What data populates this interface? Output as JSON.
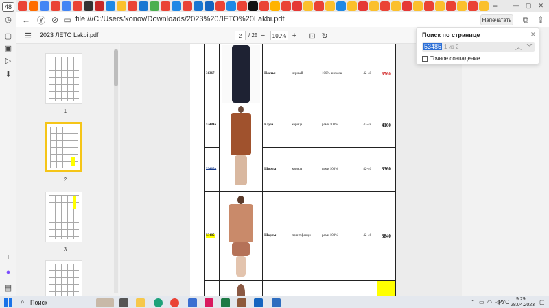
{
  "sidebar": {
    "tab_count": "48"
  },
  "browser": {
    "url": "file:///C:/Users/konov/Downloads/2023%20ЛЕТО%20Lakbi.pdf",
    "print_label": "Напечатать"
  },
  "pdf_toolbar": {
    "doc_title": "2023 ЛЕТО Lakbi.pdf",
    "current_page": "2",
    "total_pages": "/ 25",
    "zoom": "100%"
  },
  "thumbnails": [
    {
      "number": "1"
    },
    {
      "number": "2"
    },
    {
      "number": "3"
    }
  ],
  "catalog": {
    "rows": [
      {
        "article": "31367",
        "name": "Платье",
        "color": "черный",
        "composition": "100% вискоза",
        "sizes": "42-48",
        "price": "6560",
        "price_color": "#d32f2f"
      },
      {
        "article": "53484а",
        "name": "Блуза",
        "color": "корица",
        "composition": "рами 100%",
        "sizes": "42-48",
        "price": "4160",
        "price_color": "#111111"
      },
      {
        "article": "53485в",
        "name": "Шорты",
        "color": "корица",
        "composition": "рами 100%",
        "sizes": "42-46",
        "price": "3360",
        "price_color": "#111111"
      },
      {
        "article": "53485",
        "name": "Шорты",
        "color": "принт фенди",
        "composition": "рами 100%",
        "sizes": "42-46",
        "price": "3840",
        "price_color": "#111111"
      }
    ]
  },
  "find_panel": {
    "title": "Поиск по странице",
    "query": "53485",
    "count": "1 из 2",
    "exact_label": "Точное совпадение"
  },
  "taskbar": {
    "search_label": "Поиск",
    "language": "РУС",
    "time": "9:29",
    "date": "28.04.2023"
  },
  "colors": {
    "highlight_yellow": "#ffff00",
    "selected_thumb_border": "#f5c518",
    "accent_blue": "#2c6fd6"
  }
}
